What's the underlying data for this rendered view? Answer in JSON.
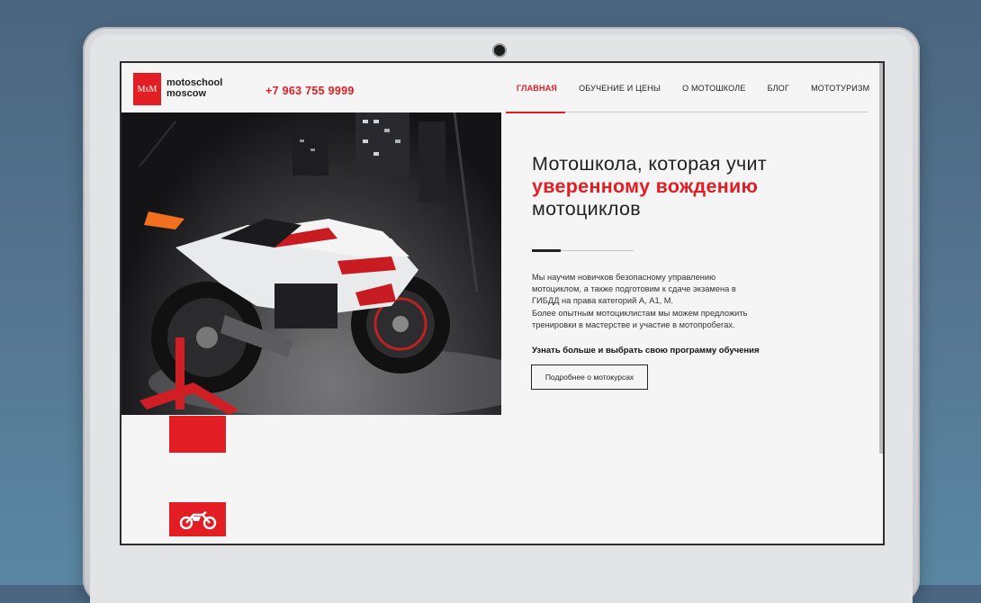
{
  "header": {
    "logo_mark": "MsM",
    "logo_line1": "motoschool",
    "logo_line2": "moscow",
    "phone": "+7 963 755 9999"
  },
  "nav": {
    "items": [
      {
        "label": "ГЛАВНАЯ",
        "active": true
      },
      {
        "label": "ОБУЧЕНИЕ И ЦЕНЫ",
        "active": false
      },
      {
        "label": "О МОТОШКОЛЕ",
        "active": false
      },
      {
        "label": "БЛОГ",
        "active": false
      },
      {
        "label": "МОТОТУРИЗМ",
        "active": false
      }
    ]
  },
  "hero": {
    "title_line1": "Мотошкола, которая учит",
    "title_line2": "уверенному вождению",
    "title_line3": "мотоциклов",
    "description_lines": [
      "Мы научим новичков безопасному управлению",
      "мотоциклом, а также подготовим к сдаче экзамена в",
      "ГИБДД на права категорий А, А1, М.",
      "Более опытным мотоциклистам мы можем предложить",
      "тренировки в мастерстве и участие в мотопробегах."
    ],
    "cta_text": "Узнать больше и выбрать свою программу обучения",
    "cta_button": "Подробнее о мотокурсах"
  },
  "colors": {
    "accent": "#e21d24",
    "text": "#222222",
    "page_background": "#f5f5f5"
  },
  "icons": {
    "floating_button": "motorcycle-icon"
  }
}
